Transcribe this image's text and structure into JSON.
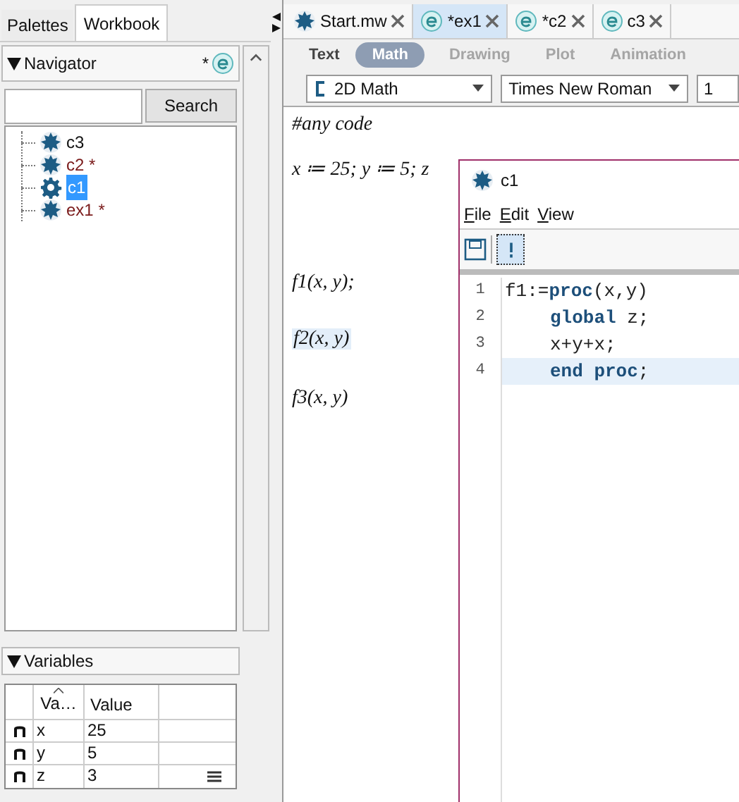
{
  "left_tabs": [
    {
      "label": "Palettes",
      "selected": false
    },
    {
      "label": "Workbook",
      "selected": true
    }
  ],
  "navigator": {
    "title": "Navigator",
    "modified_mark": "*",
    "search_button": "Search",
    "items": [
      {
        "label": "c3",
        "kind": "document",
        "modified": false,
        "selected": false
      },
      {
        "label": "c2",
        "kind": "document",
        "modified": true,
        "selected": false
      },
      {
        "label": "c1",
        "kind": "code",
        "modified": false,
        "selected": true
      },
      {
        "label": "ex1",
        "kind": "document",
        "modified": true,
        "selected": false
      }
    ]
  },
  "variables": {
    "title": "Variables",
    "columns": [
      "Va…",
      "Value"
    ],
    "rows": [
      {
        "name": "x",
        "value": "25",
        "details": false
      },
      {
        "name": "y",
        "value": "5",
        "details": false
      },
      {
        "name": "z",
        "value": "3",
        "details": true
      }
    ]
  },
  "doc_tabs": [
    {
      "label": "Start.mw",
      "kind": "worksheet",
      "selected": false
    },
    {
      "label": "*ex1",
      "kind": "code",
      "selected": true
    },
    {
      "label": "*c2",
      "kind": "code",
      "selected": false
    },
    {
      "label": "c3",
      "kind": "code",
      "selected": false
    }
  ],
  "modes": [
    {
      "label": "Text",
      "selected": false,
      "disabled": false
    },
    {
      "label": "Math",
      "selected": true,
      "disabled": false
    },
    {
      "label": "Drawing",
      "selected": false,
      "disabled": true
    },
    {
      "label": "Plot",
      "selected": false,
      "disabled": true
    },
    {
      "label": "Animation",
      "selected": false,
      "disabled": true
    }
  ],
  "input_mode": "2D Math",
  "font": "Times New Roman",
  "font_size": "1",
  "doc_lines": [
    {
      "text": "#any code",
      "highlighted": false
    },
    {
      "text": "x ≔ 25; y ≔ 5; z",
      "highlighted": false
    },
    {
      "text": "f1(x, y);",
      "highlighted": false
    },
    {
      "text": "f2(x, y)",
      "highlighted": true
    },
    {
      "text": "f3(x, y)",
      "highlighted": false
    }
  ],
  "code_window": {
    "title": "c1",
    "menu": [
      "File",
      "Edit",
      "View"
    ],
    "lines": [
      {
        "number": "1",
        "current": false,
        "indented": false,
        "tokens": [
          {
            "text": "f1:=",
            "kind": "plain"
          },
          {
            "text": "proc",
            "kind": "keyword"
          },
          {
            "text": "(x,y)",
            "kind": "plain"
          }
        ]
      },
      {
        "number": "2",
        "current": false,
        "indented": true,
        "tokens": [
          {
            "text": "global",
            "kind": "keyword"
          },
          {
            "text": " z;",
            "kind": "plain"
          }
        ]
      },
      {
        "number": "3",
        "current": false,
        "indented": true,
        "tokens": [
          {
            "text": "x+y+x;",
            "kind": "plain"
          }
        ]
      },
      {
        "number": "4",
        "current": true,
        "indented": true,
        "tokens": [
          {
            "text": "end proc",
            "kind": "keyword"
          },
          {
            "text": ";",
            "kind": "plain"
          }
        ]
      }
    ]
  }
}
